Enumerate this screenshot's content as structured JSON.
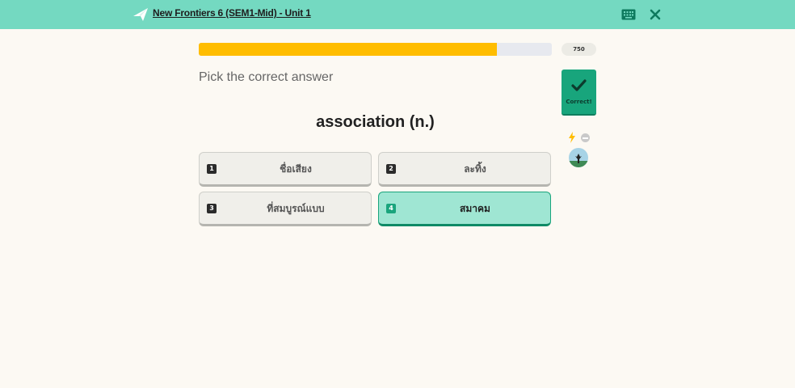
{
  "header": {
    "title": "New Frontiers 6 (SEM1-Mid) - Unit 1",
    "logo_icon": "paper-plane-icon",
    "keyboard_icon": "keyboard-icon",
    "close_icon": "close-icon",
    "bar_color": "#74d9c1"
  },
  "progress": {
    "fraction": 0.845,
    "fill_color": "#ffbd00",
    "score": "750"
  },
  "question": {
    "prompt": "Pick the correct answer",
    "word": "association (n.)"
  },
  "feedback": {
    "label": "Correct!",
    "icon": "checkmark-icon",
    "color": "#18a57c",
    "powerup_icon": "lightning-bolt-icon",
    "status_icon": "minus-circle-icon",
    "avatar_icon": "avatar-icon"
  },
  "options": [
    {
      "num": "1",
      "text": "ชื่อเสียง",
      "correct": false
    },
    {
      "num": "2",
      "text": "ละทิ้ง",
      "correct": false
    },
    {
      "num": "3",
      "text": "ที่สมบูรณ์แบบ",
      "correct": false
    },
    {
      "num": "4",
      "text": "สมาคม",
      "correct": true
    }
  ]
}
